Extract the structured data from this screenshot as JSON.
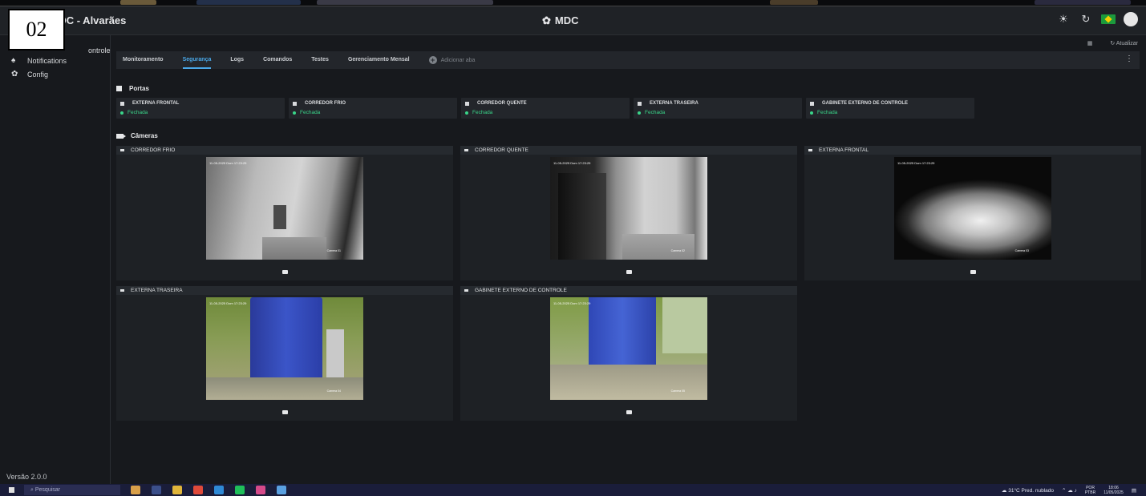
{
  "overlay_label": "02",
  "header": {
    "app_title": ": NDC - Alvarães",
    "center_title": "MDC",
    "icons": [
      "sun-icon",
      "refresh-icon",
      "brazil-flag-icon",
      "avatar"
    ]
  },
  "sidebar": {
    "items": [
      {
        "label": "ontrole",
        "icon": "control-icon"
      },
      {
        "label": "Notifications",
        "icon": "bell-icon"
      },
      {
        "label": "Config",
        "icon": "gear-icon"
      }
    ],
    "version": "Versão 2.0.0"
  },
  "toolbar": {
    "refresh_label": "Atualizar",
    "grid_icon": "grid-icon"
  },
  "tabs": [
    {
      "label": "Monitoramento",
      "active": false
    },
    {
      "label": "Segurança",
      "active": true
    },
    {
      "label": "Logs",
      "active": false
    },
    {
      "label": "Comandos",
      "active": false
    },
    {
      "label": "Testes",
      "active": false
    },
    {
      "label": "Gerenciamento Mensal",
      "active": false
    }
  ],
  "add_tab_label": "Adicionar aba",
  "portas": {
    "title": "Portas",
    "doors": [
      {
        "name": "EXTERNA FRONTAL",
        "status": "Fechada"
      },
      {
        "name": "CORREDOR FRIO",
        "status": "Fechada"
      },
      {
        "name": "CORREDOR QUENTE",
        "status": "Fechada"
      },
      {
        "name": "EXTERNA TRASEIRA",
        "status": "Fechada"
      },
      {
        "name": "GABINETE EXTERNO DE CONTROLE",
        "status": "Fechada"
      }
    ]
  },
  "cameras": {
    "title": "Câmeras",
    "items": [
      {
        "name": "CORREDOR FRIO",
        "timestamp": "11-05-2025 Dom 17:23:29",
        "cam_label": "Camera 01"
      },
      {
        "name": "CORREDOR QUENTE",
        "timestamp": "11-05-2025 Dom 17:23:29",
        "cam_label": "Camera 02"
      },
      {
        "name": "EXTERNA FRONTAL",
        "timestamp": "11-05-2025 Dom 17:23:29",
        "cam_label": "Camera 03"
      },
      {
        "name": "EXTERNA TRASEIRA",
        "timestamp": "11-05-2025 Dom 17:23:29",
        "cam_label": "Camera 04"
      },
      {
        "name": "GABINETE EXTERNO DE CONTROLE",
        "timestamp": "11-05-2025 Dom 17:23:29",
        "cam_label": "Camera 05"
      }
    ]
  },
  "taskbar": {
    "search_placeholder": "Pesquisar",
    "weather": "31°C Pred. nublado",
    "lang": "POR",
    "lang2": "PTBR",
    "time": "18:06",
    "date": "11/05/2025"
  },
  "colors": {
    "accent": "#4aa8e8",
    "status_ok": "#3ad68a",
    "panel": "#23262b"
  }
}
